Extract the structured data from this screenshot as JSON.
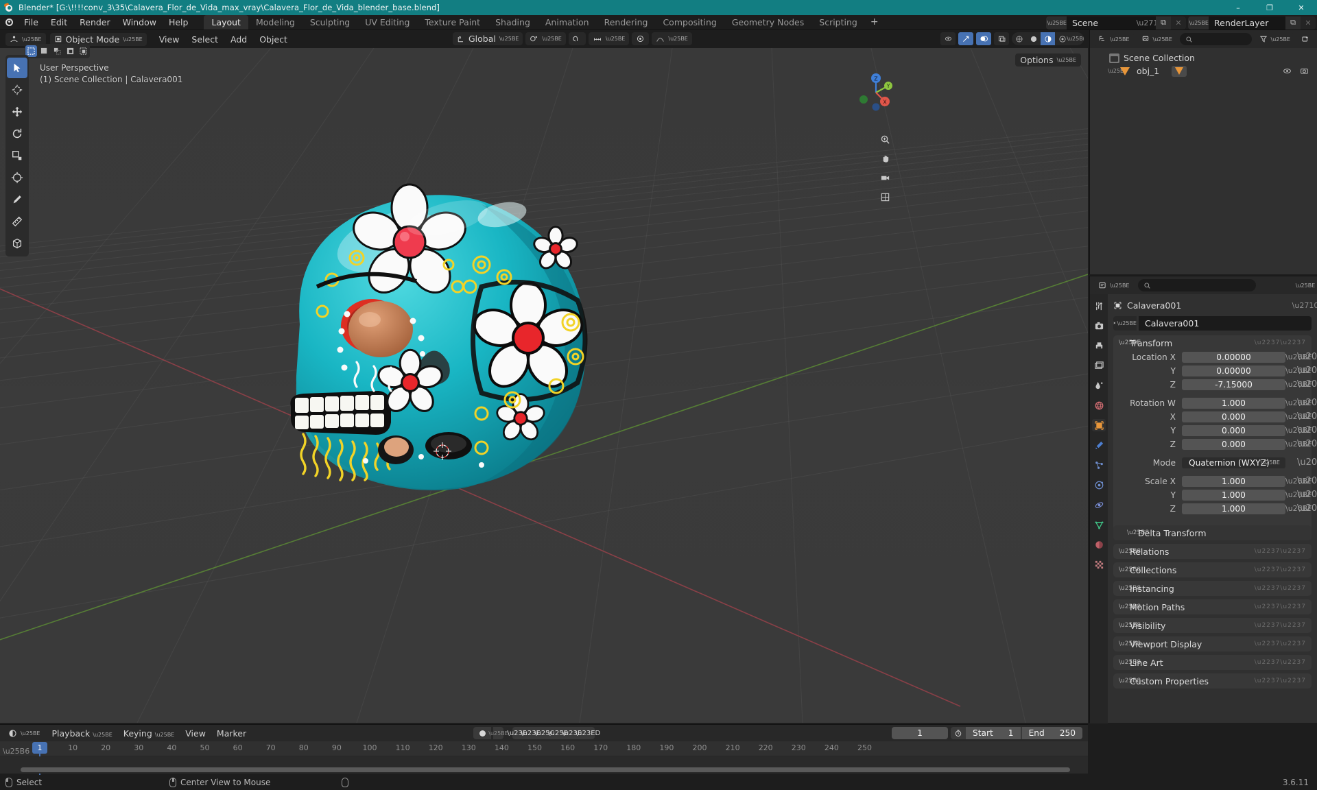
{
  "titlebar": {
    "title": "Blender* [G:\\!!!!conv_3\\35\\Calavera_Flor_de_Vida_max_vray\\Calavera_Flor_de_Vida_blender_base.blend]",
    "minimize": "–",
    "maximize": "❐",
    "close": "✕"
  },
  "topbar": {
    "menus": [
      "File",
      "Edit",
      "Render",
      "Window",
      "Help"
    ],
    "workspaces": [
      {
        "label": "Layout",
        "active": true
      },
      {
        "label": "Modeling",
        "active": false
      },
      {
        "label": "Sculpting",
        "active": false
      },
      {
        "label": "UV Editing",
        "active": false
      },
      {
        "label": "Texture Paint",
        "active": false
      },
      {
        "label": "Shading",
        "active": false
      },
      {
        "label": "Animation",
        "active": false
      },
      {
        "label": "Rendering",
        "active": false
      },
      {
        "label": "Compositing",
        "active": false
      },
      {
        "label": "Geometry Nodes",
        "active": false
      },
      {
        "label": "Scripting",
        "active": false
      }
    ],
    "add_workspace": "+",
    "scene": {
      "name": "Scene",
      "new_label": "⧉",
      "remove_label": "✕"
    },
    "view_layer": {
      "name": "RenderLayer",
      "new_label": "⧉",
      "remove_label": "✕"
    }
  },
  "viewport": {
    "mode": "Object Mode",
    "menus": [
      "View",
      "Select",
      "Add",
      "Object"
    ],
    "transform_orientation": "Global",
    "overlay_line1": "User Perspective",
    "overlay_line2": "(1) Scene Collection | Calavera001",
    "options_label": "Options",
    "gizmo_axes": [
      {
        "label": "Z",
        "color": "#3f7fd8"
      },
      {
        "label": "Y",
        "color": "#8ec63f"
      },
      {
        "label": "X",
        "color": "#e0564a"
      }
    ],
    "tools": [
      "tweak-select-tool",
      "cursor-tool",
      "move-tool",
      "rotate-tool",
      "scale-tool",
      "transform-tool",
      "annotate-tool",
      "measure-tool",
      "add-cube-tool"
    ]
  },
  "outliner": {
    "display_mode": "View Layer",
    "search_placeholder": "",
    "rows": [
      {
        "label": "Scene Collection",
        "type": "collection",
        "indent": 0
      },
      {
        "label": "obj_1",
        "type": "object",
        "indent": 1
      }
    ]
  },
  "properties": {
    "search_placeholder": "",
    "breadcrumb": "Calavera001",
    "object_name": "Calavera001",
    "tabs": [
      "tool-tab",
      "render-tab",
      "output-tab",
      "view-layer-tab",
      "scene-tab",
      "world-tab",
      "object-tab",
      "modifiers-tab",
      "particles-tab",
      "physics-tab",
      "constraints-tab",
      "data-tab",
      "material-tab",
      "texture-tab"
    ],
    "transform": {
      "title": "Transform",
      "fields": [
        {
          "label": "Location X",
          "value": "0.00000"
        },
        {
          "label": "Y",
          "value": "0.00000"
        },
        {
          "label": "Z",
          "value": "-7.15000"
        },
        {
          "label": "Rotation W",
          "value": "1.000"
        },
        {
          "label": "X",
          "value": "0.000"
        },
        {
          "label": "Y",
          "value": "0.000"
        },
        {
          "label": "Z",
          "value": "0.000"
        }
      ],
      "mode_label": "Mode",
      "mode_value": "Quaternion (WXYZ)",
      "scale": [
        {
          "label": "Scale X",
          "value": "1.000"
        },
        {
          "label": "Y",
          "value": "1.000"
        },
        {
          "label": "Z",
          "value": "1.000"
        }
      ]
    },
    "delta_transform": "Delta Transform",
    "panels": [
      "Relations",
      "Collections",
      "Instancing",
      "Motion Paths",
      "Visibility",
      "Viewport Display",
      "Line Art",
      "Custom Properties"
    ]
  },
  "timeline": {
    "menus": [
      "Playback",
      "Keying",
      "View",
      "Marker"
    ],
    "current_frame": "1",
    "start_label": "Start",
    "start_value": "1",
    "end_label": "End",
    "end_value": "250",
    "ticks": [
      10,
      20,
      30,
      40,
      50,
      60,
      70,
      80,
      90,
      100,
      110,
      120,
      130,
      140,
      150,
      160,
      170,
      180,
      190,
      200,
      210,
      220,
      230,
      240,
      250
    ],
    "playhead_frame": "1"
  },
  "status": {
    "select": "Select",
    "center_view": "Center View to Mouse",
    "version": "3.6.11"
  }
}
